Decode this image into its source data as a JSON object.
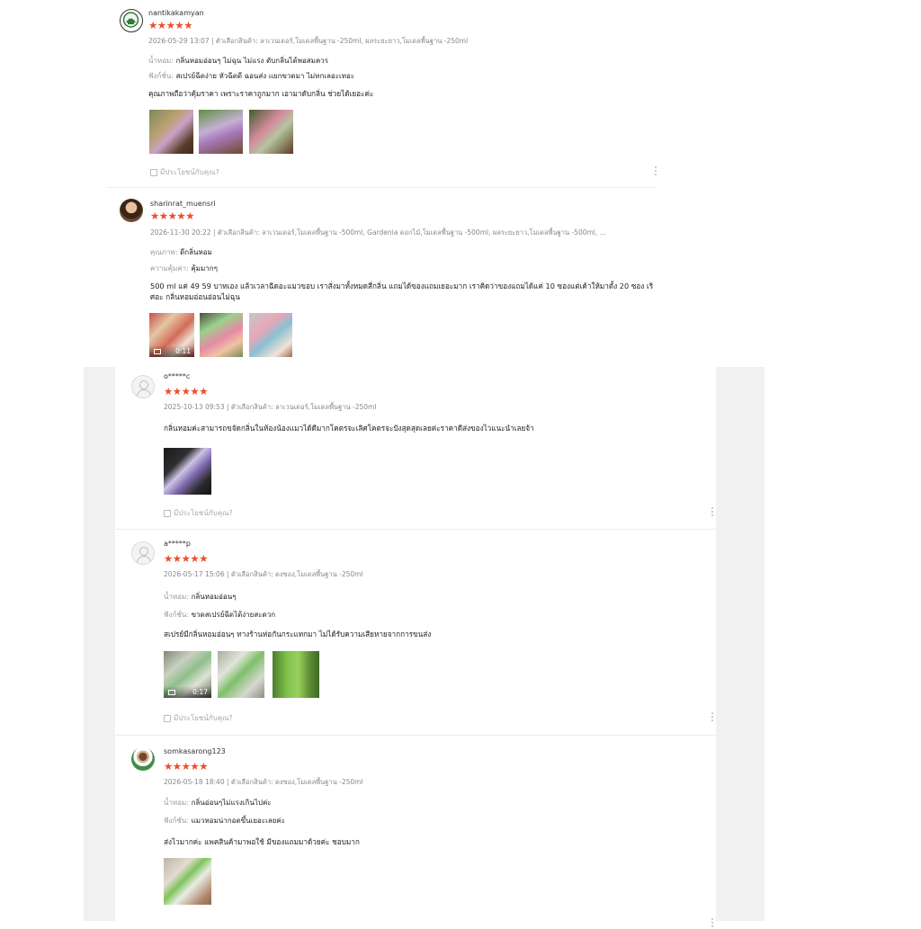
{
  "reviews": [
    {
      "username": "nantikakamyan",
      "stars": "★★★★★",
      "meta": "2026-05-29 13:07 | ตัวเลือกสินค้า: ลาเวนเดอร์,โมเดลพื้นฐาน -250ml, ผลระยะยาว,โมเดลพื้นฐาน -250ml",
      "attributes": [
        {
          "key": "น้ำหอม:",
          "value": "กลิ่นหอมอ่อนๆ ไม่ฉุน ไม่แรง ดับกลิ่นได้พอสมควร"
        },
        {
          "key": "ฟังก์ชั่น:",
          "value": "สเปรย์ฉีดง่าย หัวฉีดดี ฉอนส่ง แยกขวดมา ไม่หกเลอะเทอะ"
        }
      ],
      "text": "คุณภาพถือว่าคุ้มราคา เพราะราคาถูกมาก เอามาดับกลิ่น ช่วยได้เยอะค่ะ",
      "media": [
        {
          "video": false
        },
        {
          "video": false
        },
        {
          "video": false
        }
      ],
      "helpful": "มีประโยชน์กับคุณ?"
    },
    {
      "username": "sharinrat_muensri",
      "stars": "★★★★★",
      "meta": "2026-11-30 20:22 | ตัวเลือกสินค้า: ลาเวนเดอร์,โมเดลพื้นฐาน -500ml, Gardenia ดอกไม้,โมเดลพื้นฐาน -500ml, ผลระยะยาว,โมเดลพื้นฐาน -500ml, ...",
      "attributes": [
        {
          "key": "คุณภาพ:",
          "value": "ดีกลิ่นหอม"
        },
        {
          "key": "ความคุ้มค่า:",
          "value": "คุ้มมากๆ"
        }
      ],
      "text": "500 ml แค่ 49 59 บาทเอง แล้วเวลาฉีดอะแมวขอบ เราสั่งมาทั้งหมดสี่กลิ่น แถมได้ของแถมเยอะมาก เราคิดว่าของแถมได้แค่ 10 ซองแต่เค้าให้มาตั้ง 20 ซอง เริศอะ กลิ่นหอมอ่อนอ่อนไม่ฉุน",
      "media": [
        {
          "video": true,
          "duration": "0:11"
        },
        {
          "video": false
        },
        {
          "video": false
        }
      ],
      "helpful": ""
    },
    {
      "username": "o*****c",
      "stars": "★★★★★",
      "meta": "2025-10-13 09:53 | ตัวเลือกสินค้า: ลาเวนเดอร์,โมเดลพื้นฐาน -250ml",
      "attributes": [],
      "text": "กลิ่นหอมค่ะสามารถขจัดกลิ่นในห้องน้องแมวได้ดีมากโคตรจะเลิศโคตรจะปังสุดสุดเลยค่ะราคาดีส่งของไวแนะนำเลยจ้า",
      "media": [
        {
          "video": false
        }
      ],
      "helpful": "มีประโยชน์กับคุณ?"
    },
    {
      "username": "a*****p",
      "stars": "★★★★★",
      "meta": "2026-05-17 15:06 | ตัวเลือกสินค้า: ดงซอง,โมเดลพื้นฐาน -250ml",
      "attributes": [
        {
          "key": "น้ำหอม:",
          "value": "กลิ่นหอมอ่อนๆ"
        },
        {
          "key": "ฟังก์ชั่น:",
          "value": "ขวดสเปรย์ฉีดได้ง่ายสะดวก"
        }
      ],
      "text": "สเปรย์มีกลิ่นหอมอ่อนๆ ทางร้านห่อกันกระแทกมา ไม่ได้รับความเสียหายจากการขนส่ง",
      "media": [
        {
          "video": true,
          "duration": "0:17"
        },
        {
          "video": false
        },
        {
          "video": false
        }
      ],
      "helpful": "มีประโยชน์กับคุณ?"
    },
    {
      "username": "somkasarong123",
      "stars": "★★★★★",
      "meta": "2026-05-18 18:40 | ตัวเลือกสินค้า: ดงซอง,โมเดลพื้นฐาน -250ml",
      "attributes": [
        {
          "key": "น้ำหอม:",
          "value": "กลิ่นอ่อนๆไม่แรงเกินไปค่ะ"
        },
        {
          "key": "ฟังก์ชั่น:",
          "value": "แมวหอมน่ากอดขึ้นเยอะเลยค่ะ"
        }
      ],
      "text": "ส่งไวมากค่ะ แพคสินค้ามาพอใช้ มีของแถมมาด้วยค่ะ ชอบมาก",
      "media": [
        {
          "video": false
        }
      ],
      "helpful": ""
    }
  ]
}
